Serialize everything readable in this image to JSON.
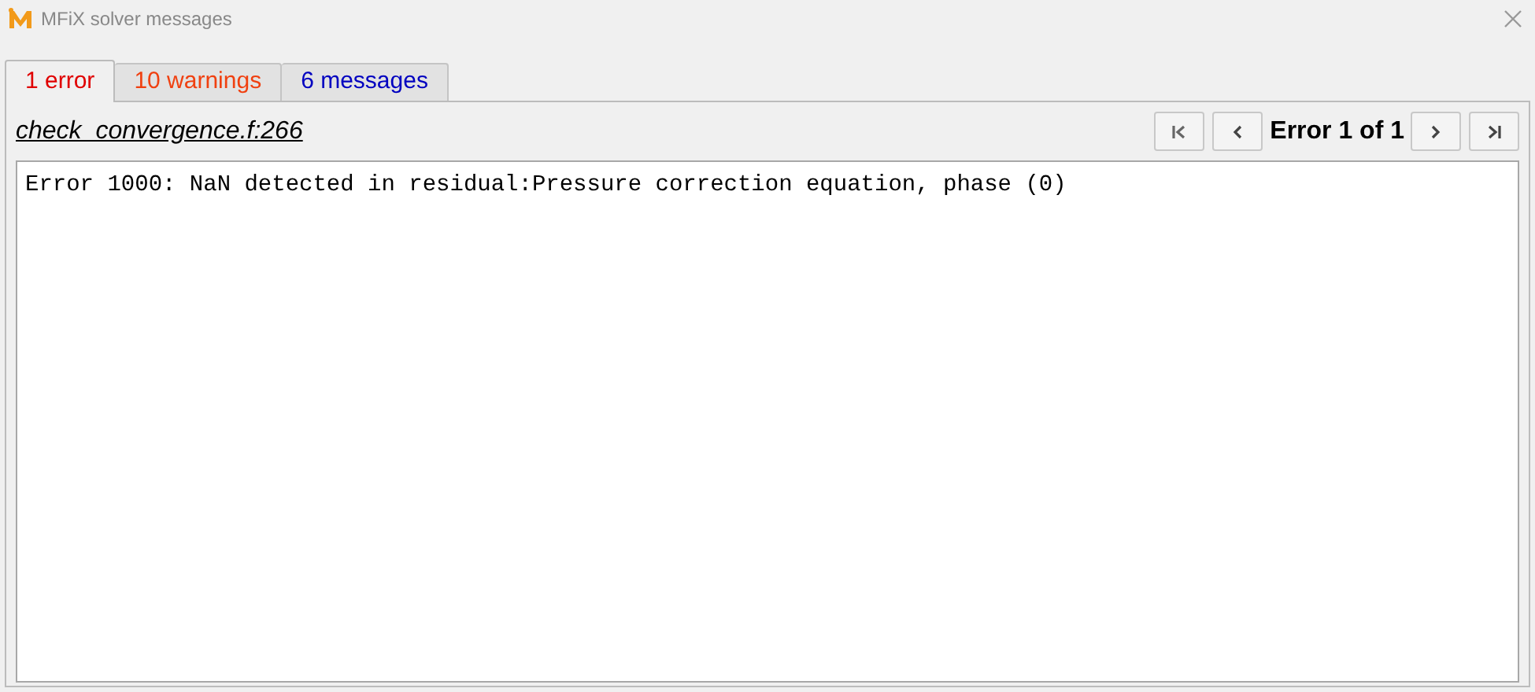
{
  "window": {
    "title": "MFiX solver messages"
  },
  "tabs": [
    {
      "label": "1 error",
      "selected": true,
      "color": "#e00000"
    },
    {
      "label": "10 warnings",
      "selected": false,
      "color": "#f04010"
    },
    {
      "label": "6 messages",
      "selected": false,
      "color": "#0000c0"
    }
  ],
  "source_link": "check_convergence.f:266",
  "counter": "Error 1 of 1",
  "message": "Error 1000: NaN detected in residual:Pressure correction equation, phase (0)"
}
